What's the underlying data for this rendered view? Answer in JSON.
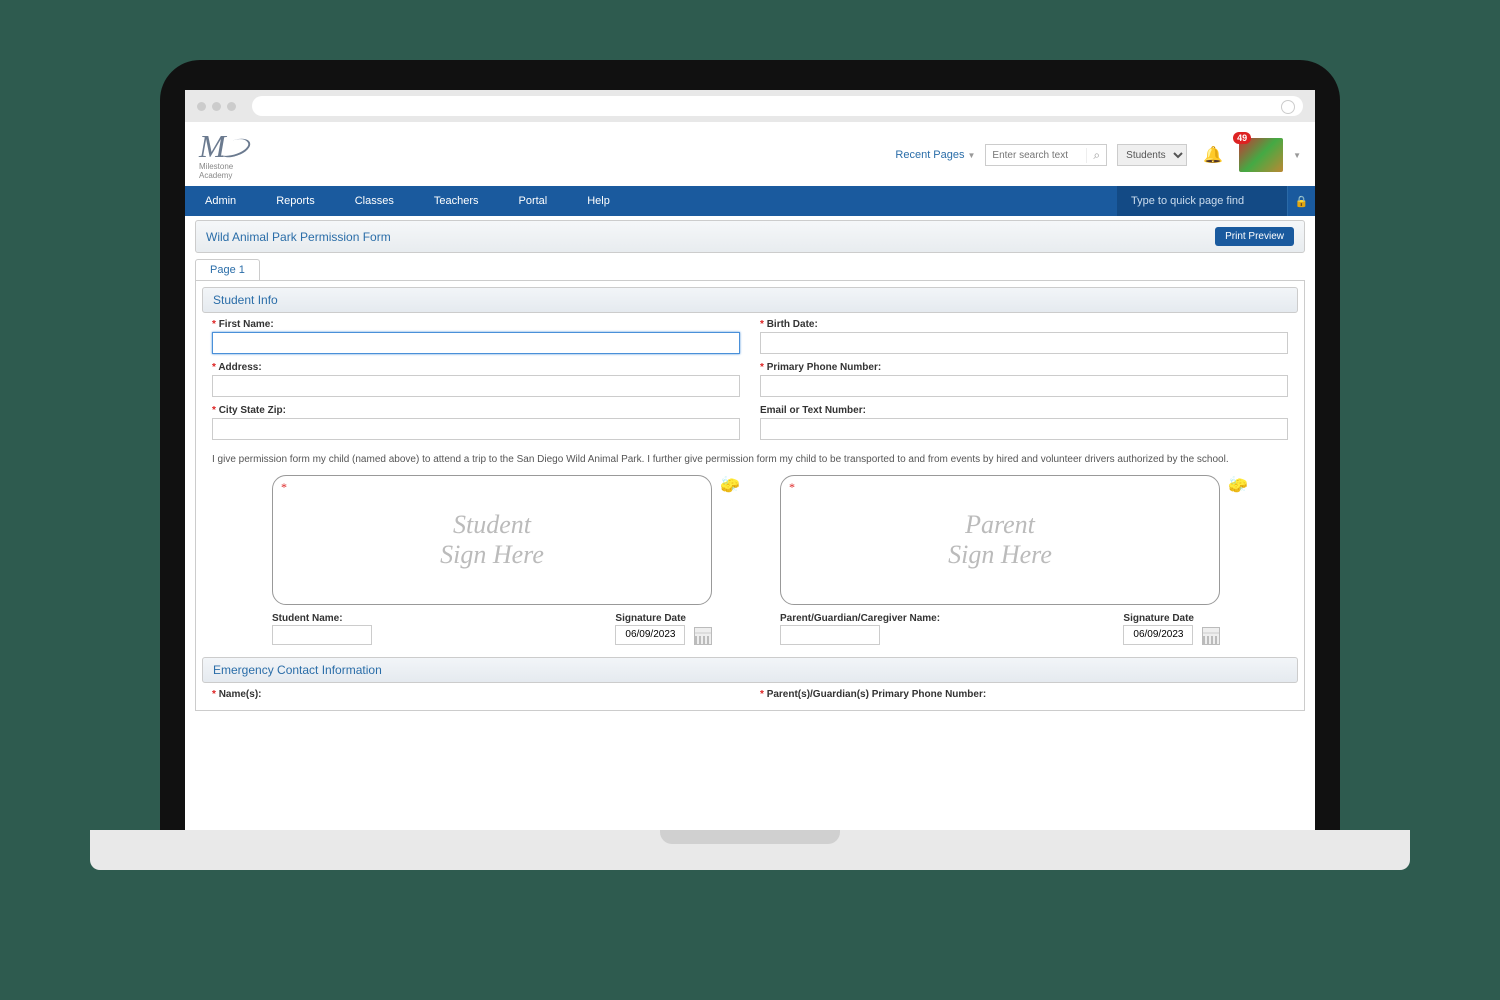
{
  "logo_subtext": "Milestone Academy",
  "header": {
    "recent_pages": "Recent Pages",
    "search_placeholder": "Enter search text",
    "scope": "Students",
    "notification_count": "49"
  },
  "nav": {
    "items": [
      "Admin",
      "Reports",
      "Classes",
      "Teachers",
      "Portal",
      "Help"
    ],
    "quick_find_placeholder": "Type to quick page find"
  },
  "page": {
    "title": "Wild Animal Park Permission Form",
    "print_preview": "Print Preview",
    "tab": "Page 1"
  },
  "student_info": {
    "heading": "Student Info",
    "first_name_label": "First Name:",
    "birth_date_label": "Birth Date:",
    "address_label": "Address:",
    "phone_label": "Primary Phone Number:",
    "csz_label": "City State Zip:",
    "email_label": "Email or Text Number:"
  },
  "permission_text": "I give permission form my child (named above) to attend a trip to the San Diego Wild Animal Park. I further give permission form my child to be transported to and from events by hired and volunteer drivers authorized by the school.",
  "signatures": {
    "student": {
      "placeholder_l1": "Student",
      "placeholder_l2": "Sign Here",
      "name_label": "Student Name:",
      "date_label": "Signature Date",
      "date_value": "06/09/2023"
    },
    "parent": {
      "placeholder_l1": "Parent",
      "placeholder_l2": "Sign Here",
      "name_label": "Parent/Guardian/Caregiver Name:",
      "date_label": "Signature Date",
      "date_value": "06/09/2023"
    }
  },
  "emergency": {
    "heading": "Emergency Contact Information",
    "names_label": "Name(s):",
    "phone_label": "Parent(s)/Guardian(s) Primary Phone Number:"
  }
}
